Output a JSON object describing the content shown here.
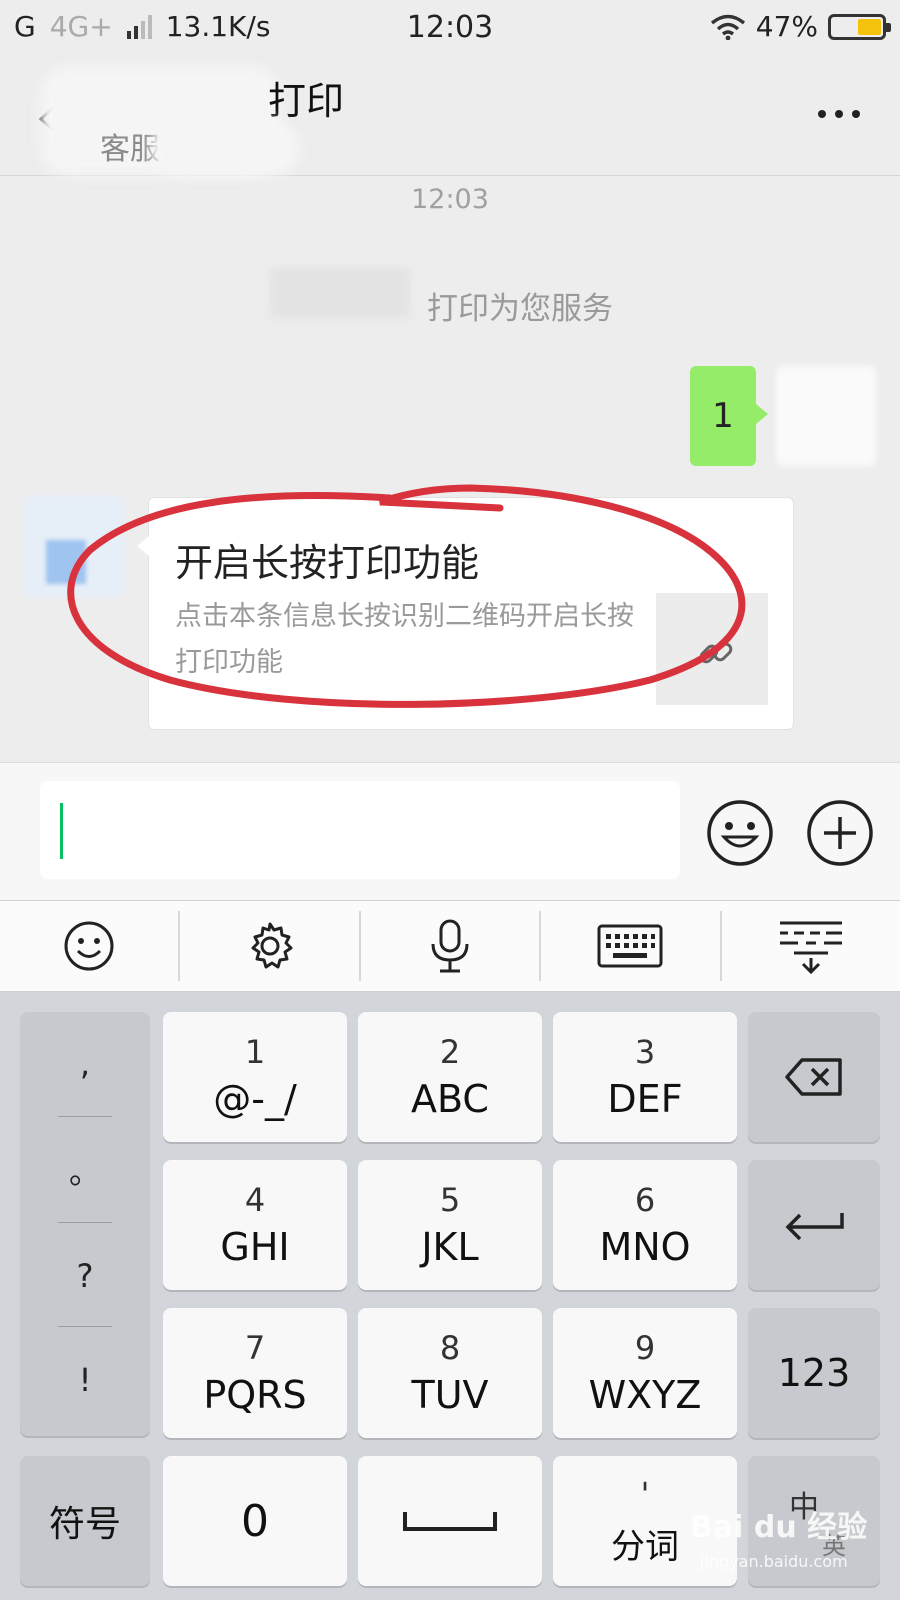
{
  "status_bar": {
    "carrier": "G",
    "network": "4G+",
    "speed": "13.1K/s",
    "time": "12:03",
    "battery": "47%",
    "battery_level": 0.47
  },
  "header": {
    "title_suffix": "打印",
    "subtitle_suffix": "客服会",
    "more_icon": "more-horizontal-icon",
    "back_icon": "chevron-left-icon"
  },
  "chat": {
    "timestamp": "12:03",
    "system_message": "打印为您服务",
    "my_message": "1",
    "card": {
      "title": "开启长按打印功能",
      "description": "点击本条信息长按识别二维码开启长按打印功能",
      "thumb_icon": "link-icon"
    }
  },
  "input": {
    "value": "",
    "emoji_icon": "smile-icon",
    "plus_icon": "plus-circle-icon"
  },
  "ime_toolbar": [
    {
      "icon": "smile-icon"
    },
    {
      "icon": "gear-icon"
    },
    {
      "icon": "microphone-icon"
    },
    {
      "icon": "keyboard-icon"
    },
    {
      "icon": "collapse-keyboard-icon"
    }
  ],
  "keyboard": {
    "punctuation": [
      ",",
      "。",
      "?",
      "!"
    ],
    "keys": [
      {
        "num": "1",
        "letters": "@-_/"
      },
      {
        "num": "2",
        "letters": "ABC"
      },
      {
        "num": "3",
        "letters": "DEF"
      },
      {
        "num": "4",
        "letters": "GHI"
      },
      {
        "num": "5",
        "letters": "JKL"
      },
      {
        "num": "6",
        "letters": "MNO"
      },
      {
        "num": "7",
        "letters": "PQRS"
      },
      {
        "num": "8",
        "letters": "TUV"
      },
      {
        "num": "9",
        "letters": "WXYZ"
      }
    ],
    "backspace_icon": "backspace-icon",
    "enter_icon": "enter-icon",
    "numbers_label": "123",
    "symbols_label": "符号",
    "zero_label": "0",
    "space_icon": "space-icon",
    "split_top": "'",
    "split_label": "分词",
    "lang_label": "中",
    "lang_sub": "英"
  },
  "watermark": {
    "logo": "Bai du 经验",
    "url": "jingyan.baidu.com"
  },
  "colors": {
    "accent": "#07c160",
    "my_bubble": "#95ec69",
    "annotation": "#d8323c",
    "battery": "#f4c20d"
  }
}
